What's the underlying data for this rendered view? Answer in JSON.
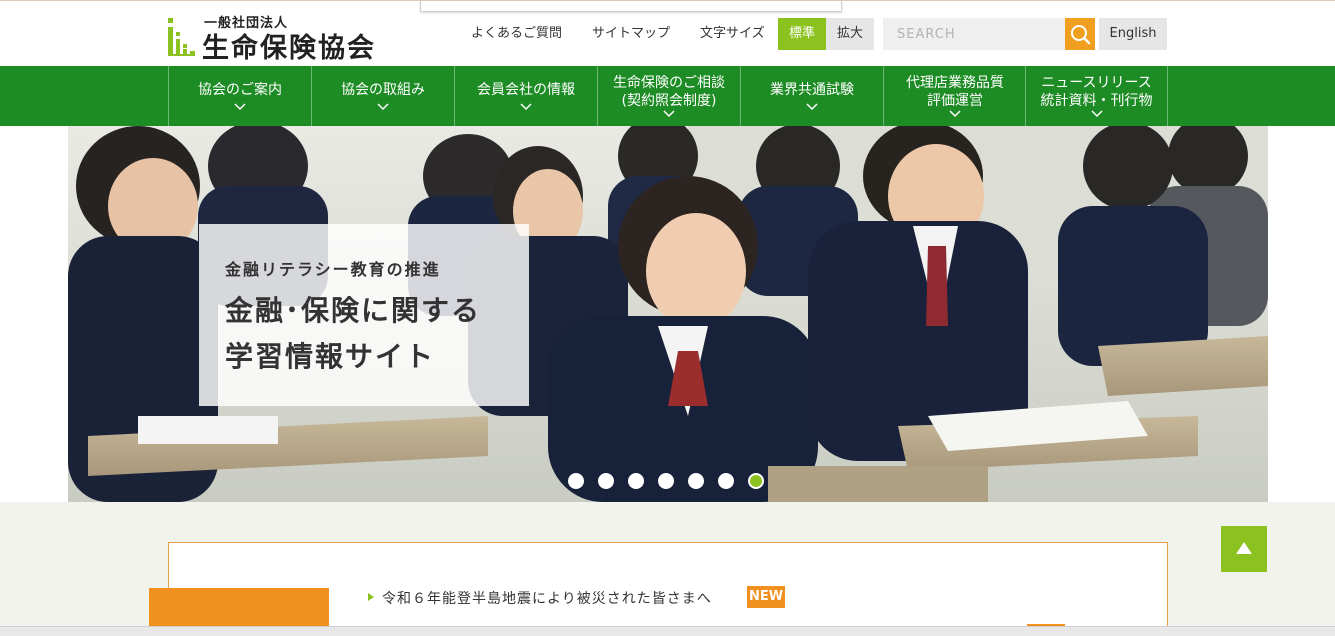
{
  "logo": {
    "small": "一般社団法人",
    "big": "生命保険協会"
  },
  "utility": {
    "faq": "よくあるご質問",
    "sitemap": "サイトマップ",
    "text_size_label": "文字サイズ",
    "size_standard": "標準",
    "size_large": "拡大"
  },
  "search": {
    "placeholder": "SEARCH"
  },
  "english": "English",
  "nav": [
    {
      "line1": "協会のご案内",
      "line2": ""
    },
    {
      "line1": "協会の取組み",
      "line2": ""
    },
    {
      "line1": "会員会社の情報",
      "line2": ""
    },
    {
      "line1": "生命保険のご相談",
      "line2": "(契約照会制度)"
    },
    {
      "line1": "業界共通試験",
      "line2": ""
    },
    {
      "line1": "代理店業務品質",
      "line2": "評価運営"
    },
    {
      "line1": "ニュースリリース",
      "line2": "統計資料・刊行物"
    }
  ],
  "hero": {
    "subtitle": "金融リテラシー教育の推進",
    "title_line1": "金融･保険に関する",
    "title_line2": "学習情報サイト",
    "slides": 7,
    "active_slide": 7
  },
  "news": {
    "item1": "令和６年能登半島地震により被災された皆さまへ",
    "badge": "NEW"
  },
  "colors": {
    "brand_green": "#1e8c25",
    "accent_lime": "#8cc21f",
    "accent_orange": "#f0901e"
  },
  "icons": {
    "search": "search-icon",
    "chevron": "chevron-down-icon",
    "pagetop": "arrow-up-icon"
  }
}
